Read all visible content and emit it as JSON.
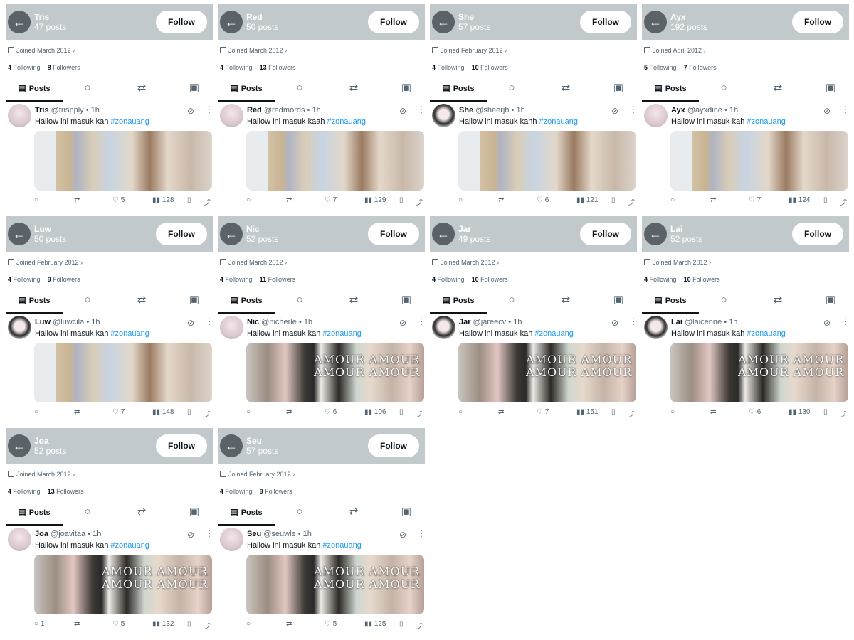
{
  "ui": {
    "back_icon": "←",
    "follow_label": "Follow",
    "following_word": "Following",
    "followers_word": "Followers",
    "posts_tab_label": "Posts",
    "time_ago": "1h",
    "separator": "•"
  },
  "cards": [
    {
      "name": "Tris",
      "posts": "47 posts",
      "joined": "Joined March 2012",
      "following": "4",
      "followers": "8",
      "handle": "@trispply",
      "text": "Hallow ini masuk kah",
      "hashtag": "#zonauang",
      "replies": "",
      "likes": "5",
      "views": "128",
      "media": "A"
    },
    {
      "name": "Red",
      "posts": "50 posts",
      "joined": "Joined March 2012",
      "following": "4",
      "followers": "13",
      "handle": "@redmords",
      "text": "Hallow ini masuk kaah",
      "hashtag": "#zonauang",
      "replies": "",
      "likes": "7",
      "views": "129",
      "media": "A"
    },
    {
      "name": "She",
      "posts": "57 posts",
      "joined": "Joined February 2012",
      "following": "4",
      "followers": "10",
      "handle": "@sheerjh",
      "text": "Hallow ini masuk kahh",
      "hashtag": "#zonauang",
      "replies": "",
      "likes": "6",
      "views": "121",
      "media": "A"
    },
    {
      "name": "Ayx",
      "posts": "192 posts",
      "joined": "Joined April 2012",
      "following": "5",
      "followers": "7",
      "handle": "@ayxdine",
      "text": "Hallow ini masuk kah",
      "hashtag": "#zonauang",
      "replies": "",
      "likes": "7",
      "views": "124",
      "media": "A"
    },
    {
      "name": "Luw",
      "posts": "50 posts",
      "joined": "Joined February 2012",
      "following": "4",
      "followers": "9",
      "handle": "@luwcila",
      "text": "Hallow ini masuk kah",
      "hashtag": "#zonauang",
      "replies": "",
      "likes": "7",
      "views": "148",
      "media": "A"
    },
    {
      "name": "Nic",
      "posts": "52 posts",
      "joined": "Joined March 2012",
      "following": "4",
      "followers": "11",
      "handle": "@nicherle",
      "text": "Hallow ini masuk kah",
      "hashtag": "#zonauang",
      "replies": "",
      "likes": "6",
      "views": "106",
      "media": "B"
    },
    {
      "name": "Jar",
      "posts": "49 posts",
      "joined": "Joined March 2012",
      "following": "4",
      "followers": "10",
      "handle": "@jareecv",
      "text": "Hallow ini masuk kah",
      "hashtag": "#zonauang",
      "replies": "",
      "likes": "7",
      "views": "151",
      "media": "B"
    },
    {
      "name": "Lai",
      "posts": "52 posts",
      "joined": "Joined March 2012",
      "following": "4",
      "followers": "10",
      "handle": "@laicenne",
      "text": "Hallow ini masuk kah",
      "hashtag": "#zonauang",
      "replies": "",
      "likes": "6",
      "views": "130",
      "media": "B"
    },
    {
      "name": "Joa",
      "posts": "52 posts",
      "joined": "Joined March 2012",
      "following": "4",
      "followers": "13",
      "handle": "@joavitaa",
      "text": "Hallow ini masuk kah",
      "hashtag": "#zonauang",
      "replies": "1",
      "likes": "5",
      "views": "132",
      "media": "B"
    },
    {
      "name": "Seu",
      "posts": "57 posts",
      "joined": "Joined February 2012",
      "following": "4",
      "followers": "9",
      "handle": "@seuwle",
      "text": "Hallow ini masuk kah",
      "hashtag": "#zonauang",
      "replies": "",
      "likes": "5",
      "views": "125",
      "media": "B"
    }
  ],
  "media_overlay_text": "AMOUR AMOUR AMOUR AMOUR",
  "icons": {
    "calendar": "calendar-icon",
    "reply": "reply-icon",
    "retweet": "retweet-icon",
    "like": "heart-icon",
    "views": "views-icon",
    "bookmark": "bookmark-icon",
    "share": "share-icon",
    "grok": "grok-icon",
    "more": "more-icon"
  },
  "colors": {
    "header_bg": "#c2c9cc",
    "back_button": "#5b6368",
    "hashtag": "#1d9bf0",
    "muted_text": "#536471"
  }
}
